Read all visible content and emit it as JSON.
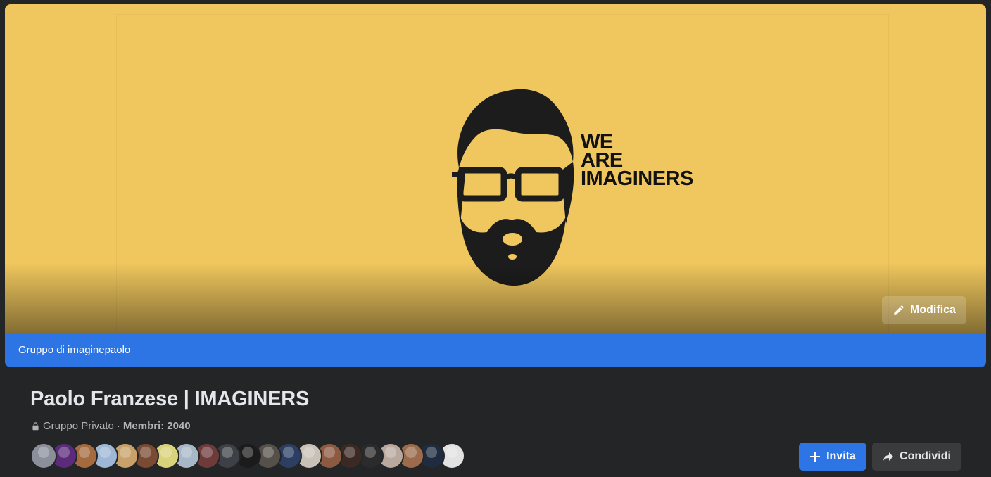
{
  "cover": {
    "brand_lines": [
      "WE",
      "ARE",
      "IMAGINERS"
    ],
    "edit_label": "Modifica",
    "edit_icon": "pencil-icon",
    "background_color": "#f0c75e"
  },
  "group_banner": {
    "label": "Gruppo di imaginepaolo",
    "color": "#2d74e5"
  },
  "group": {
    "title": "Paolo Franzese | IMAGINERS",
    "privacy_icon": "lock-icon",
    "privacy": "Gruppo Privato",
    "separator": "·",
    "members_label": "Membri:",
    "members_count": "2040"
  },
  "member_avatars": [
    {
      "name": "member-avatar",
      "color": "#8a8f9a"
    },
    {
      "name": "member-avatar",
      "color": "#5b2a7a"
    },
    {
      "name": "member-avatar",
      "color": "#a56a3e"
    },
    {
      "name": "member-avatar",
      "color": "#9fb7d6"
    },
    {
      "name": "member-avatar",
      "color": "#c8a06a"
    },
    {
      "name": "member-avatar",
      "color": "#7a4a33"
    },
    {
      "name": "member-avatar",
      "color": "#d8d27a"
    },
    {
      "name": "member-avatar",
      "color": "#a7b7c7"
    },
    {
      "name": "member-avatar",
      "color": "#6e3b3b"
    },
    {
      "name": "member-avatar",
      "color": "#3d4046"
    },
    {
      "name": "member-avatar",
      "color": "#1b1b1b"
    },
    {
      "name": "member-avatar",
      "color": "#55504a"
    },
    {
      "name": "member-avatar",
      "color": "#2c3f63"
    },
    {
      "name": "member-avatar",
      "color": "#c9c0b7"
    },
    {
      "name": "member-avatar",
      "color": "#8c5a41"
    },
    {
      "name": "member-avatar",
      "color": "#3b2a24"
    },
    {
      "name": "member-avatar",
      "color": "#2b2b2b"
    },
    {
      "name": "member-avatar",
      "color": "#b9a89e"
    },
    {
      "name": "member-avatar",
      "color": "#9b6b4b"
    },
    {
      "name": "member-avatar",
      "color": "#1f2b3f"
    },
    {
      "name": "member-avatar",
      "color": "#e2e2e2"
    }
  ],
  "actions": {
    "invite_label": "Invita",
    "invite_icon": "plus-icon",
    "share_label": "Condividi",
    "share_icon": "share-arrow-icon"
  }
}
